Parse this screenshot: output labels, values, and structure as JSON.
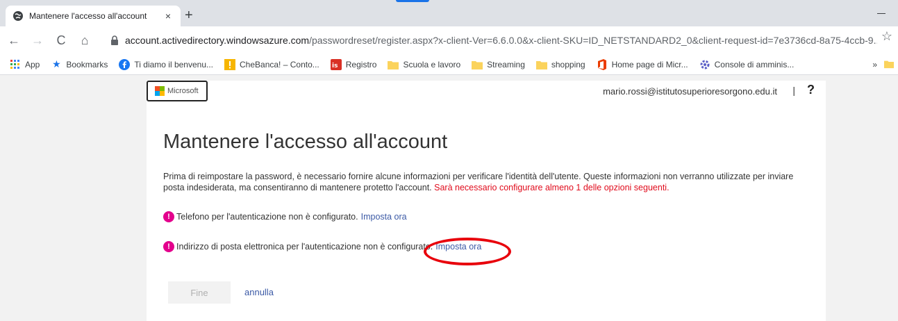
{
  "browser": {
    "tab_title": "Mantenere l'accesso all'account",
    "tab_close": "×",
    "new_tab": "+",
    "url_host": "account.activedirectory.windowsazure.com",
    "url_rest": "/passwordreset/register.aspx?x-client-Ver=6.6.0.0&x-client-SKU=ID_NETSTANDARD2_0&client-request-id=7e3736cd-8a75-4ccb-9...",
    "back": "←",
    "forward": "→",
    "reload": "C",
    "home": "⌂",
    "star": "☆"
  },
  "bookmarks": [
    {
      "label": "App",
      "icon": "apps-grid-icon"
    },
    {
      "label": "Bookmarks",
      "icon": "star-icon"
    },
    {
      "label": "Ti diamo il benvenu...",
      "icon": "facebook-icon"
    },
    {
      "label": "CheBanca! – Conto...",
      "icon": "chebanca-icon"
    },
    {
      "label": "Registro",
      "icon": "registro-icon"
    },
    {
      "label": "Scuola e lavoro",
      "icon": "folder-icon"
    },
    {
      "label": "Streaming",
      "icon": "folder-icon"
    },
    {
      "label": "shopping",
      "icon": "folder-icon"
    },
    {
      "label": "Home page di Micr...",
      "icon": "office-icon"
    },
    {
      "label": "Console di amminis...",
      "icon": "admin-icon"
    }
  ],
  "bookmarks_more": "»",
  "page": {
    "logo_text": "Microsoft",
    "user_email": "mario.rossi@istitutosuperioresorgono.edu.it",
    "separator": "|",
    "help": "?",
    "heading": "Mantenere l'accesso all'account",
    "intro_text": "Prima di reimpostare la password, è necessario fornire alcune informazioni per verificare l'identità dell'utente. Queste informazioni non verranno utilizzate per inviare posta indesiderata, ma consentiranno di mantenere protetto l'account.",
    "intro_warning": "Sarà necessario configurare almeno 1 delle opzioni seguenti.",
    "item1_text": "Telefono per l'autenticazione non è configurato.",
    "item1_link": "Imposta ora",
    "item2_text": "Indirizzo di posta elettronica per l'autenticazione non è configurato.",
    "item2_link": "Imposta ora",
    "alert_glyph": "!",
    "finish_label": "Fine",
    "cancel_label": "annulla"
  },
  "colors": {
    "alert": "#e3008c",
    "warning_text": "#e00b1c",
    "link": "#3c5aa6",
    "annotation_ellipse": "#e8000b"
  }
}
